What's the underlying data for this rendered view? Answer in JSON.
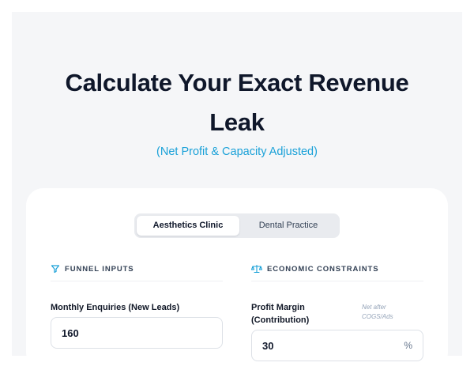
{
  "header": {
    "title_line1": "Calculate Your Exact Revenue",
    "title_line2": "Leak",
    "subtitle": "(Net Profit & Capacity Adjusted)"
  },
  "tabs": [
    {
      "label": "Aesthetics Clinic",
      "active": true
    },
    {
      "label": "Dental Practice",
      "active": false
    }
  ],
  "funnel": {
    "heading": "FUNNEL INPUTS",
    "icon": "filter-icon",
    "enquiries_label": "Monthly Enquiries (New Leads)",
    "enquiries_value": "160"
  },
  "economics": {
    "heading": "ECONOMIC CONSTRAINTS",
    "icon": "scale-icon",
    "margin_label_line1": "Profit Margin",
    "margin_label_line2": "(Contribution)",
    "margin_note_line1": "Net after",
    "margin_note_line2": "COGS/Ads",
    "margin_value": "30",
    "margin_unit": "%"
  },
  "colors": {
    "accent": "#1aa1d8",
    "heading": "#0f172a",
    "background": "#f5f6f8"
  }
}
